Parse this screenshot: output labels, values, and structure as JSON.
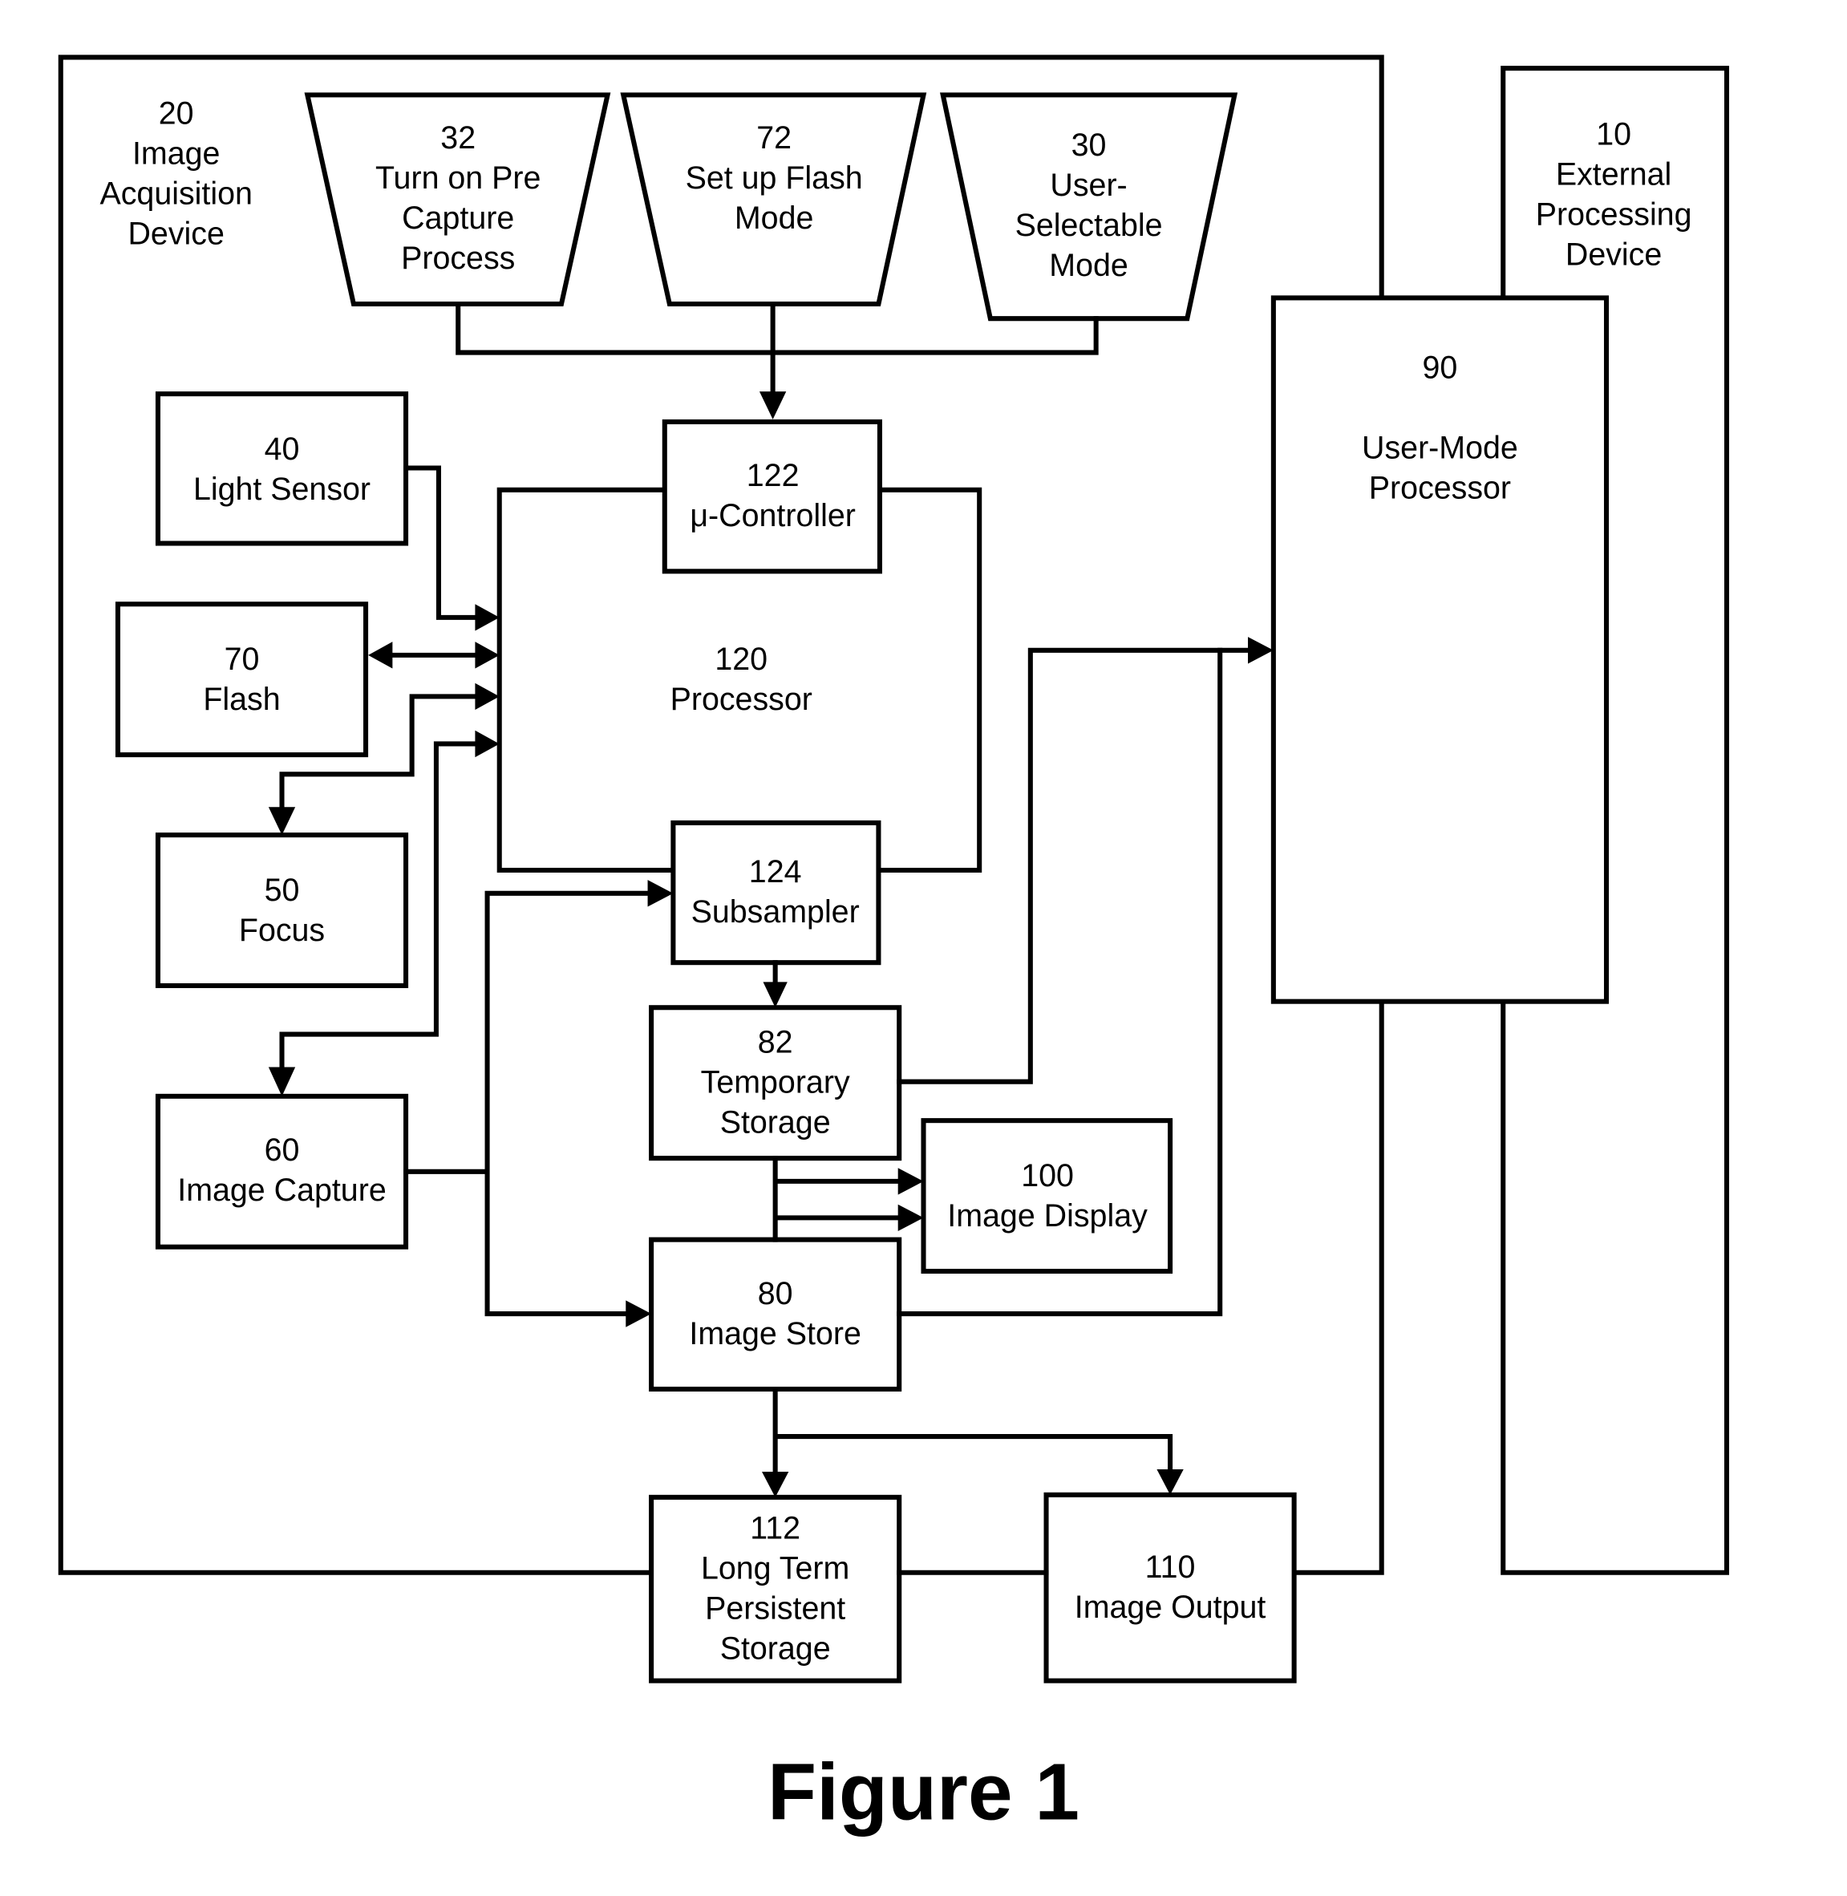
{
  "figure_title": "Figure 1",
  "blocks": {
    "b20": {
      "lines": [
        "20",
        "Image",
        "Acquisition",
        "Device"
      ]
    },
    "b10": {
      "lines": [
        "10",
        "External",
        "Processing",
        "Device"
      ]
    },
    "b32": {
      "lines": [
        "32",
        "Turn on Pre",
        "Capture",
        "Process"
      ]
    },
    "b72": {
      "lines": [
        "72",
        "Set up Flash",
        "Mode"
      ]
    },
    "b30": {
      "lines": [
        "30",
        "User-",
        "Selectable",
        "Mode"
      ]
    },
    "b122": {
      "lines": [
        "122",
        "μ-Controller"
      ]
    },
    "b120": {
      "lines": [
        "120",
        "Processor"
      ]
    },
    "b124": {
      "lines": [
        "124",
        "Subsampler"
      ]
    },
    "b40": {
      "lines": [
        "40",
        "Light Sensor"
      ]
    },
    "b70": {
      "lines": [
        "70",
        "Flash"
      ]
    },
    "b50": {
      "lines": [
        "50",
        "Focus"
      ]
    },
    "b60": {
      "lines": [
        "60",
        "Image Capture"
      ]
    },
    "b82": {
      "lines": [
        "82",
        "Temporary",
        "Storage"
      ]
    },
    "b100": {
      "lines": [
        "100",
        "Image Display"
      ]
    },
    "b80": {
      "lines": [
        "80",
        "Image Store"
      ]
    },
    "b112": {
      "lines": [
        "112",
        "Long Term",
        "Persistent",
        "Storage"
      ]
    },
    "b110": {
      "lines": [
        "110",
        "Image Output"
      ]
    },
    "b90": {
      "lines": [
        "90",
        "",
        "User-Mode",
        "Processor"
      ]
    }
  }
}
